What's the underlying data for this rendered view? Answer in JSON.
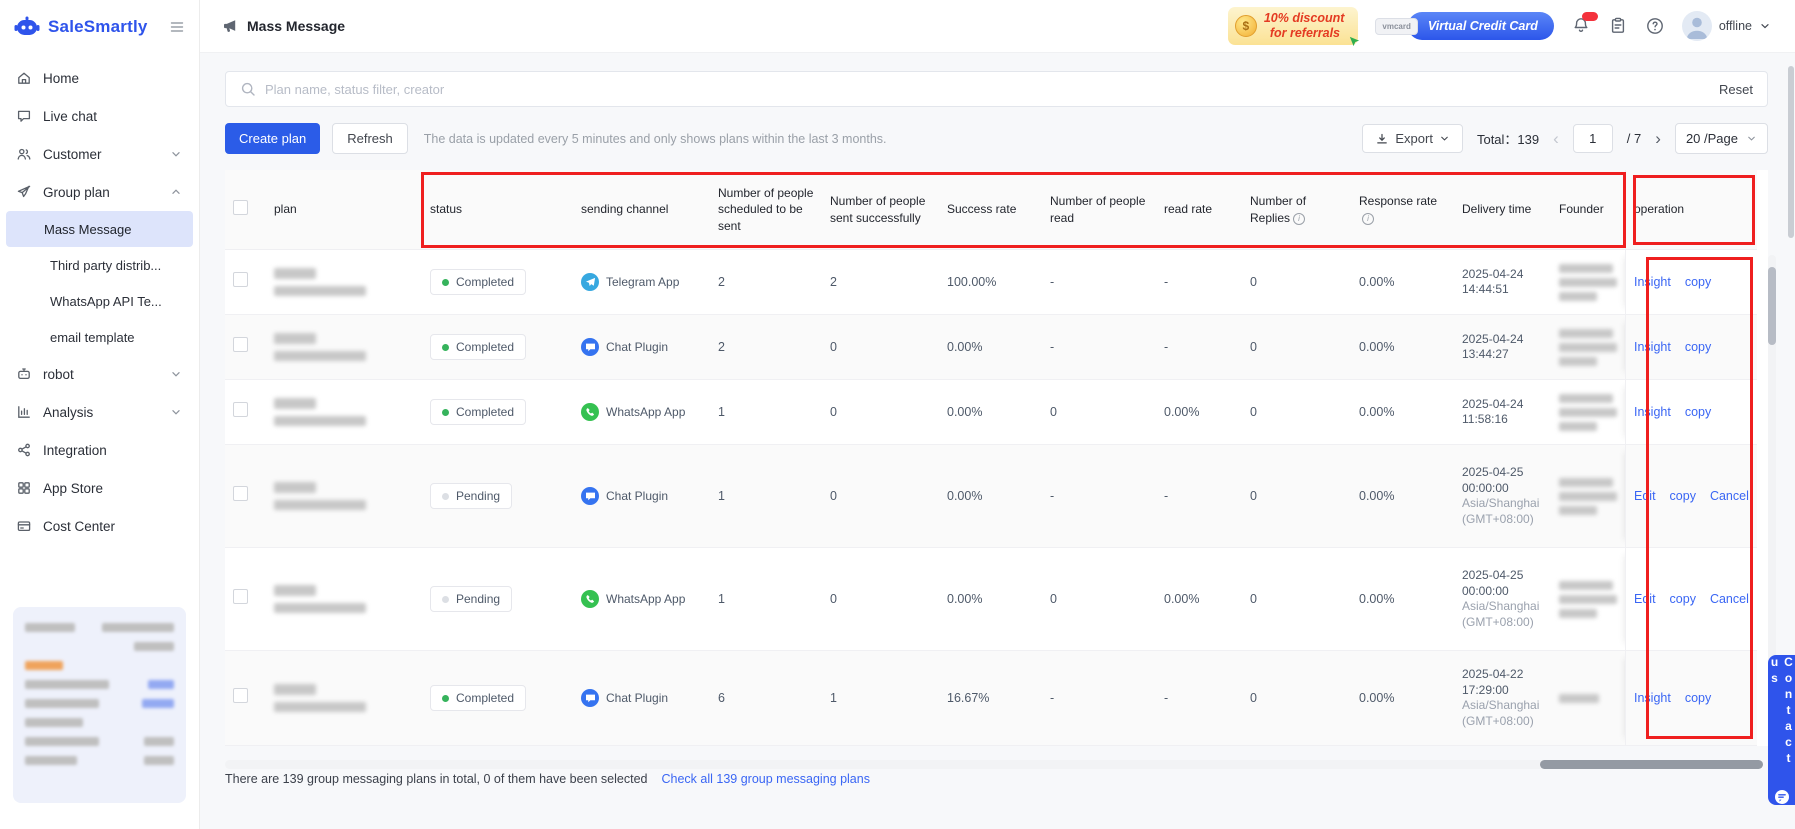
{
  "brand": {
    "name": "SaleSmartly"
  },
  "header": {
    "page_title": "Mass Message",
    "promo_line1": "10% discount",
    "promo_line2": "for referrals",
    "vmcard_label": "vmcard",
    "vcc_label": "Virtual Credit Card",
    "presence": "offline"
  },
  "sidebar": {
    "items": [
      {
        "label": "Home"
      },
      {
        "label": "Live chat"
      },
      {
        "label": "Customer"
      },
      {
        "label": "Group plan"
      },
      {
        "label": "robot"
      },
      {
        "label": "Analysis"
      },
      {
        "label": "Integration"
      },
      {
        "label": "App Store"
      },
      {
        "label": "Cost Center"
      }
    ],
    "group_plan_children": [
      {
        "label": "Mass Message",
        "active": true
      },
      {
        "label": "Third party distrib...",
        "active": false
      },
      {
        "label": "WhatsApp API Te...",
        "active": false
      },
      {
        "label": "email template",
        "active": false
      }
    ]
  },
  "search": {
    "placeholder": "Plan name, status filter, creator",
    "reset_label": "Reset"
  },
  "toolbar": {
    "create_plan_label": "Create plan",
    "refresh_label": "Refresh",
    "note": "The data is updated every 5 minutes and only shows plans within the last 3 months.",
    "export_label": "Export",
    "total_label": "Total：139",
    "page_current": "1",
    "page_separator": "/",
    "page_total": "7",
    "page_size_label": "20 /Page"
  },
  "table": {
    "headers": {
      "plan": "plan",
      "status": "status",
      "channel": "sending channel",
      "scheduled": "Number of people scheduled to be sent",
      "sent": "Number of people sent successfully",
      "success": "Success rate",
      "read": "Number of people read",
      "read_rate": "read rate",
      "replies": "Number of Replies",
      "response": "Response rate",
      "delivery": "Delivery time",
      "founder": "Founder",
      "operation": "operation"
    },
    "rows": [
      {
        "status": "Completed",
        "status_type": "success",
        "channel": "Telegram App",
        "channel_type": "telegram",
        "scheduled": "2",
        "sent": "2",
        "success_rate": "100.00%",
        "read": "-",
        "read_rate": "-",
        "replies": "0",
        "response_rate": "0.00%",
        "delivery": "2025-04-24 14:44:51",
        "timezone": "",
        "ops": [
          "Insight",
          "copy"
        ],
        "size": "std",
        "founder_lines": 3
      },
      {
        "status": "Completed",
        "status_type": "success",
        "channel": "Chat Plugin",
        "channel_type": "chat",
        "scheduled": "2",
        "sent": "0",
        "success_rate": "0.00%",
        "read": "-",
        "read_rate": "-",
        "replies": "0",
        "response_rate": "0.00%",
        "delivery": "2025-04-24 13:44:27",
        "timezone": "",
        "ops": [
          "Insight",
          "copy"
        ],
        "size": "std",
        "founder_lines": 3
      },
      {
        "status": "Completed",
        "status_type": "success",
        "channel": "WhatsApp App",
        "channel_type": "whatsapp",
        "scheduled": "1",
        "sent": "0",
        "success_rate": "0.00%",
        "read": "0",
        "read_rate": "0.00%",
        "replies": "0",
        "response_rate": "0.00%",
        "delivery": "2025-04-24 11:58:16",
        "timezone": "",
        "ops": [
          "Insight",
          "copy"
        ],
        "size": "std",
        "founder_lines": 3
      },
      {
        "status": "Pending",
        "status_type": "pending",
        "channel": "Chat Plugin",
        "channel_type": "chat",
        "scheduled": "1",
        "sent": "0",
        "success_rate": "0.00%",
        "read": "-",
        "read_rate": "-",
        "replies": "0",
        "response_rate": "0.00%",
        "delivery": "2025-04-25 00:00:00",
        "timezone": "Asia/Shanghai(GMT+08:00)",
        "ops": [
          "Edit",
          "copy",
          "Cancel"
        ],
        "size": "lg",
        "founder_lines": 3
      },
      {
        "status": "Pending",
        "status_type": "pending",
        "channel": "WhatsApp App",
        "channel_type": "whatsapp",
        "scheduled": "1",
        "sent": "0",
        "success_rate": "0.00%",
        "read": "0",
        "read_rate": "0.00%",
        "replies": "0",
        "response_rate": "0.00%",
        "delivery": "2025-04-25 00:00:00",
        "timezone": "Asia/Shanghai(GMT+08:00)",
        "ops": [
          "Edit",
          "copy",
          "Cancel"
        ],
        "size": "lg",
        "founder_lines": 3
      },
      {
        "status": "Completed",
        "status_type": "success",
        "channel": "Chat Plugin",
        "channel_type": "chat",
        "scheduled": "6",
        "sent": "1",
        "success_rate": "16.67%",
        "read": "-",
        "read_rate": "-",
        "replies": "0",
        "response_rate": "0.00%",
        "delivery": "2025-04-22 17:29:00",
        "timezone": "Asia/Shanghai(GMT+08:00)",
        "ops": [
          "Insight",
          "copy"
        ],
        "size": "md",
        "founder_lines": 1
      }
    ]
  },
  "footer": {
    "summary": "There are 139 group messaging plans in total, 0 of them have been selected",
    "link_label": "Check all 139 group messaging plans"
  },
  "contact_label": "Contact us"
}
